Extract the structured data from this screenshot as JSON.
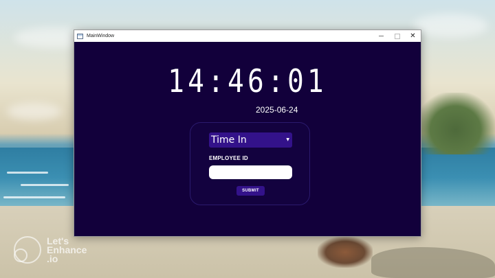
{
  "window": {
    "title": "MainWindow"
  },
  "clock": {
    "time": "14:46:01",
    "date": "2025-06-24"
  },
  "form": {
    "mode_select": {
      "selected": "Time In"
    },
    "employee_id_label": "EMPLOYEE ID",
    "employee_id_value": "",
    "submit_label": "SUBMIT"
  },
  "watermark": {
    "line1": "Let's",
    "line2": "Enhance",
    "line3": ".io"
  },
  "colors": {
    "window_bg": "#12003b",
    "accent": "#33128a",
    "text": "#ffffff"
  },
  "icons": {
    "app": "window-app-icon",
    "minimize": "minimize-icon",
    "maximize": "maximize-icon",
    "close": "close-icon",
    "dropdown": "chevron-down-icon"
  }
}
